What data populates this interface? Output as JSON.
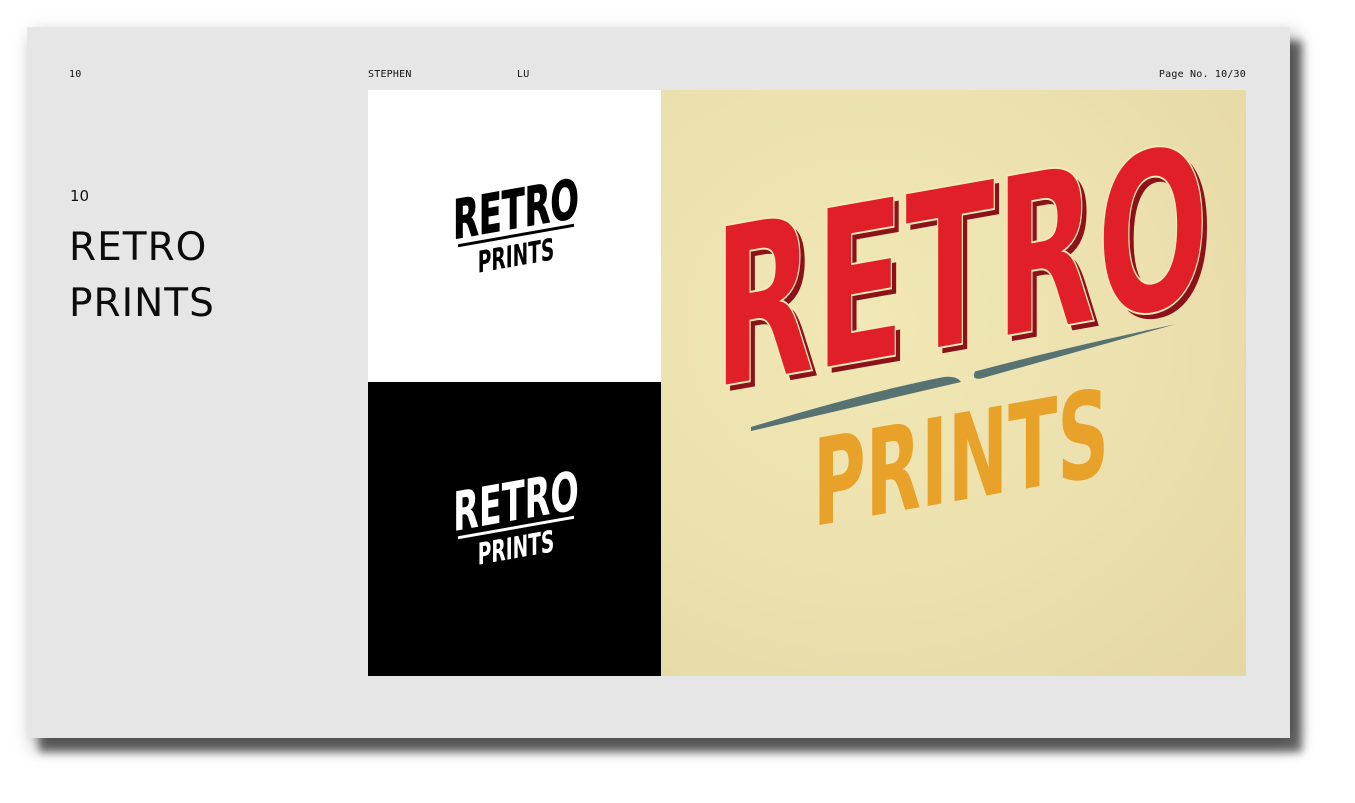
{
  "header": {
    "number": "10",
    "author_first": "STEPHEN",
    "author_last": "LU",
    "page_label": "Page No. 10/30"
  },
  "section": {
    "number": "10",
    "title_line1": "RETRO",
    "title_line2": "PRINTS"
  },
  "logo": {
    "word1": "RETRO",
    "word2": "PRINTS"
  },
  "colors": {
    "page_bg": "#e6e6e6",
    "logo_red": "#e01f28",
    "logo_orange": "#e8a22a",
    "logo_teal": "#567372",
    "cream_bg": "#ede3b1"
  }
}
